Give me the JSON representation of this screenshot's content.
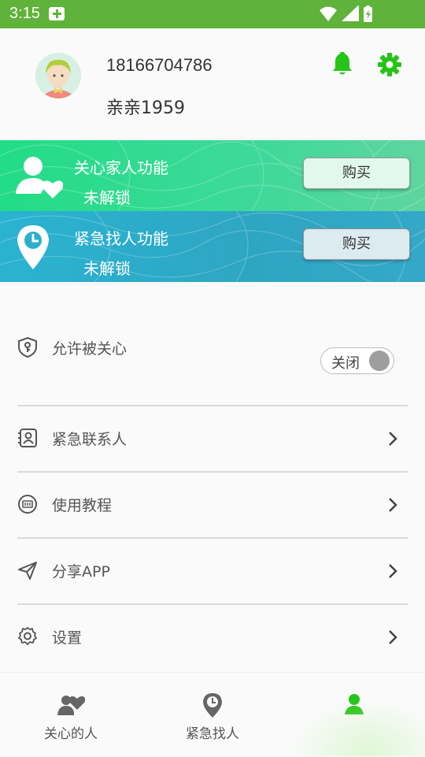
{
  "status_bar": {
    "time": "3:15"
  },
  "profile": {
    "phone": "18166704786",
    "nickname": "亲亲1959"
  },
  "banners": [
    {
      "title": "关心家人功能",
      "status": "未解锁",
      "button": "购买"
    },
    {
      "title": "紧急找人功能",
      "status": "未解锁",
      "button": "购买"
    }
  ],
  "menu": {
    "allow_care": {
      "label": "允许被关心",
      "toggle_text": "关闭",
      "enabled": false
    },
    "items": [
      {
        "label": "紧急联系人",
        "icon": "contact-card-icon"
      },
      {
        "label": "使用教程",
        "icon": "tutorial-icon"
      },
      {
        "label": "分享APP",
        "icon": "paper-plane-icon"
      },
      {
        "label": "设置",
        "icon": "gear-icon"
      }
    ]
  },
  "tabs": [
    {
      "label": "关心的人",
      "icon": "people-heart-icon",
      "active": false
    },
    {
      "label": "紧急找人",
      "icon": "location-clock-icon",
      "active": false
    },
    {
      "label": "",
      "icon": "person-icon",
      "active": true
    }
  ],
  "colors": {
    "status_bar": "#5fb23a",
    "accent_green": "#25c417",
    "care_banner": "#2bdc8c",
    "emergency_banner": "#2ab0cc",
    "tab_icon": "#666666"
  }
}
